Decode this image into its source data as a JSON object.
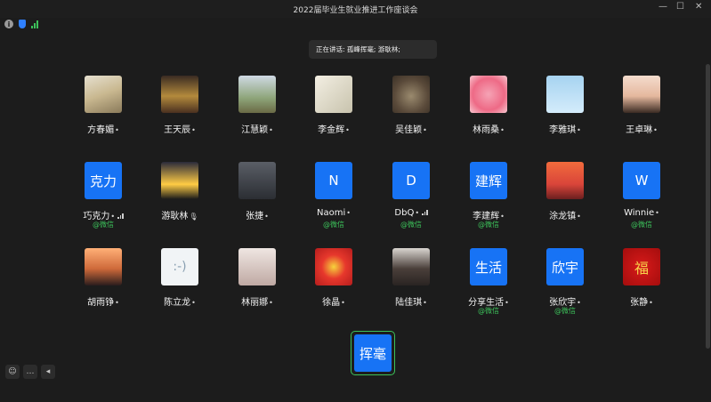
{
  "window": {
    "title": "2022届毕业生就业推进工作座谈会",
    "minimize": "—",
    "maximize": "☐",
    "close": "✕"
  },
  "speaking": {
    "text": "正在讲话: 孤峰挥毫; 游耿林;"
  },
  "participants": [
    {
      "name": "方春媚",
      "avatar": "coffee"
    },
    {
      "name": "王天辰",
      "avatar": "night"
    },
    {
      "name": "江慧颖",
      "avatar": "field"
    },
    {
      "name": "李金辉",
      "avatar": "sketch"
    },
    {
      "name": "吴佳颖",
      "avatar": "cat"
    },
    {
      "name": "林雨桑",
      "avatar": "pink"
    },
    {
      "name": "李雅琪",
      "avatar": "cloud"
    },
    {
      "name": "王卓琳",
      "avatar": "girl"
    },
    {
      "name": "巧克力",
      "avatar_text": "克力"
    },
    {
      "name": "游耿林",
      "avatar": "man"
    },
    {
      "name": "张捷",
      "avatar": "dark"
    },
    {
      "name": "Naomi",
      "avatar_text": "N"
    },
    {
      "name": "DbQ",
      "avatar_text": "D"
    },
    {
      "name": "李建辉",
      "avatar_text": "建辉"
    },
    {
      "name": "涂龙镇",
      "avatar": "sunset"
    },
    {
      "name": "Winnie",
      "avatar_text": "W"
    },
    {
      "name": "胡雨铮",
      "avatar": "orange"
    },
    {
      "name": "陈立龙",
      "avatar": "face"
    },
    {
      "name": "林丽娜",
      "avatar": "portrait"
    },
    {
      "name": "徐晶",
      "avatar": "red"
    },
    {
      "name": "陆佳琪",
      "avatar": "bw"
    },
    {
      "name": "分享生活",
      "avatar_text": "生活"
    },
    {
      "name": "张欣宇",
      "avatar_text": "欣宇"
    },
    {
      "name": "张静",
      "avatar": "fu"
    }
  ],
  "wechat_label": "@微信",
  "face_glyph": ":-)",
  "fu_glyph": "福",
  "active_speaker": {
    "avatar_text": "挥毫"
  },
  "toolbar": {
    "chat_icon": "…",
    "collapse_icon": "◂",
    "emoji_icon": "☺"
  }
}
